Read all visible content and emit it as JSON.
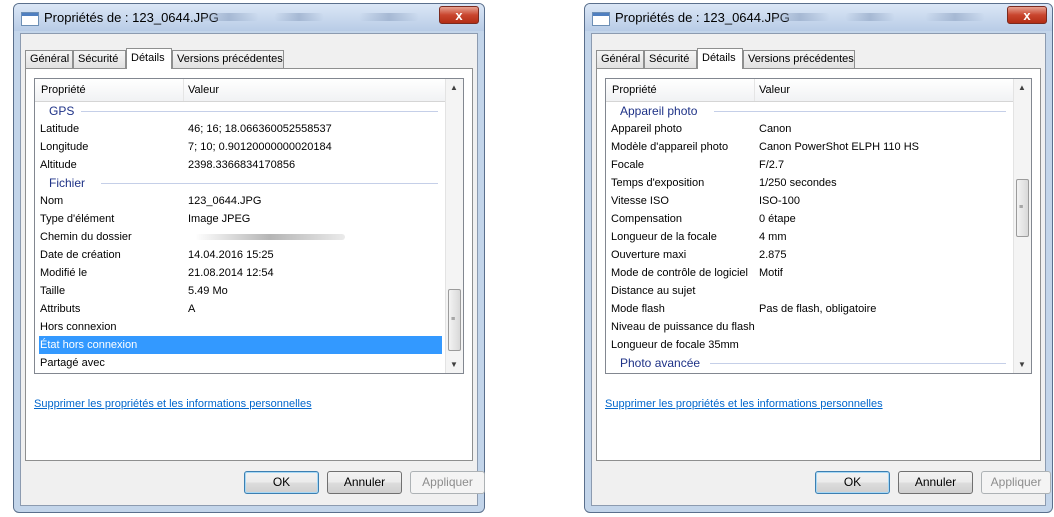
{
  "left": {
    "title": "Propriétés de : 123_0644.JPG",
    "close": "x",
    "tabs": [
      "Général",
      "Sécurité",
      "Détails",
      "Versions précédentes"
    ],
    "header": {
      "prop": "Propriété",
      "val": "Valeur"
    },
    "groups": {
      "gps": "GPS",
      "file": "Fichier"
    },
    "rows": [
      {
        "p": "Latitude",
        "v": "46; 16; 18.066360052558537"
      },
      {
        "p": "Longitude",
        "v": "7; 10; 0.90120000000020184"
      },
      {
        "p": "Altitude",
        "v": "2398.3366834170856"
      },
      {
        "p": "Nom",
        "v": "123_0644.JPG"
      },
      {
        "p": "Type d'élément",
        "v": "Image JPEG"
      },
      {
        "p": "Chemin du dossier",
        "v": ""
      },
      {
        "p": "Date de création",
        "v": "14.04.2016 15:25"
      },
      {
        "p": "Modifié le",
        "v": "21.08.2014 12:54"
      },
      {
        "p": "Taille",
        "v": "5.49 Mo"
      },
      {
        "p": "Attributs",
        "v": "A"
      },
      {
        "p": "Hors connexion",
        "v": ""
      },
      {
        "p": "État hors connexion",
        "v": ""
      },
      {
        "p": "Partagé avec",
        "v": ""
      }
    ],
    "link": "Supprimer les propriétés et les informations personnelles",
    "buttons": {
      "ok": "OK",
      "cancel": "Annuler",
      "apply": "Appliquer"
    }
  },
  "right": {
    "title": "Propriétés de : 123_0644.JPG",
    "close": "x",
    "tabs": [
      "Général",
      "Sécurité",
      "Détails",
      "Versions précédentes"
    ],
    "header": {
      "prop": "Propriété",
      "val": "Valeur"
    },
    "groups": {
      "camera": "Appareil photo",
      "advanced": "Photo avancée"
    },
    "rows": [
      {
        "p": "Appareil photo",
        "v": "Canon"
      },
      {
        "p": "Modèle d'appareil photo",
        "v": "Canon PowerShot ELPH 110 HS"
      },
      {
        "p": "Focale",
        "v": "F/2.7"
      },
      {
        "p": "Temps d'exposition",
        "v": "1/250 secondes"
      },
      {
        "p": "Vitesse ISO",
        "v": "ISO-100"
      },
      {
        "p": "Compensation",
        "v": "0 étape"
      },
      {
        "p": "Longueur de la focale",
        "v": "4 mm"
      },
      {
        "p": "Ouverture maxi",
        "v": "2.875"
      },
      {
        "p": "Mode de contrôle de logiciel",
        "v": "Motif"
      },
      {
        "p": "Distance au sujet",
        "v": ""
      },
      {
        "p": "Mode flash",
        "v": "Pas de flash, obligatoire"
      },
      {
        "p": "Niveau de puissance du flash",
        "v": ""
      },
      {
        "p": "Longueur de focale 35mm",
        "v": ""
      }
    ],
    "link": "Supprimer les propriétés et les informations personnelles",
    "buttons": {
      "ok": "OK",
      "cancel": "Annuler",
      "apply": "Appliquer"
    }
  },
  "colors": {
    "selection": "#3399ff",
    "link": "#0066cc",
    "group": "#1e3287",
    "close": "#c9452e"
  }
}
